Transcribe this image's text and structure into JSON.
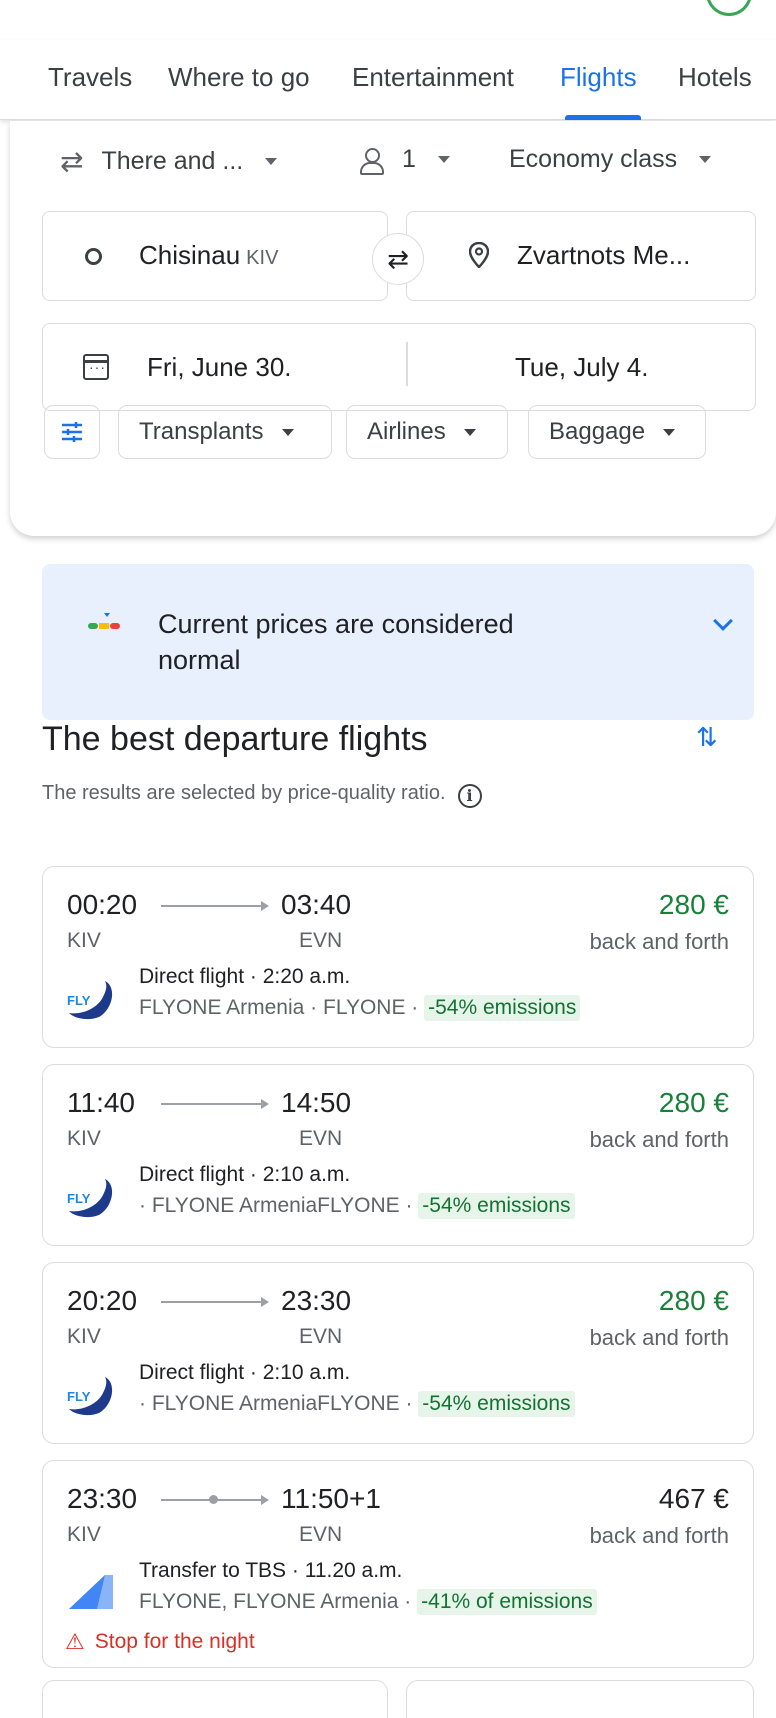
{
  "nav": {
    "tabs": [
      {
        "label": "Travels"
      },
      {
        "label": "Where to go"
      },
      {
        "label": "Entertainment"
      },
      {
        "label": "Flights"
      },
      {
        "label": "Hotels"
      }
    ],
    "active": "Flights"
  },
  "search": {
    "trip_type": "There and ...",
    "passengers": "1",
    "cabin": "Economy class",
    "origin_city": "Chisinau",
    "origin_code": "KIV",
    "destination": "Zvartnots Me...",
    "depart_date": "Fri, June 30.",
    "return_date": "Tue, July 4.",
    "chips": [
      "Transplants",
      "Airlines",
      "Baggage"
    ]
  },
  "insight": {
    "text": "Current prices are considered normal"
  },
  "results": {
    "title": "The best departure flights",
    "subtitle": "The results are selected by price-quality ratio."
  },
  "flights": [
    {
      "depart_time": "00:20",
      "arrive_time": "03:40",
      "from": "KIV",
      "to": "EVN",
      "price": "280 €",
      "price_note": "back and forth",
      "summary": "Direct flight · 2:20 a.m.",
      "airline": "FLYONE Armenia · FLYONE · ",
      "emissions": "-54% emissions"
    },
    {
      "depart_time": "11:40",
      "arrive_time": "14:50",
      "from": "KIV",
      "to": "EVN",
      "price": "280 €",
      "price_note": "back and forth",
      "summary": "Direct flight · 2:10 a.m.",
      "airline": " · FLYONE ArmeniaFLYONE · ",
      "emissions": "-54% emissions"
    },
    {
      "depart_time": "20:20",
      "arrive_time": "23:30",
      "from": "KIV",
      "to": "EVN",
      "price": "280 €",
      "price_note": "back and forth",
      "summary": "Direct flight · 2:10 a.m.",
      "airline": " · FLYONE ArmeniaFLYONE · ",
      "emissions": "-54% emissions"
    },
    {
      "depart_time": "23:30",
      "arrive_time": "11:50+1",
      "from": "KIV",
      "to": "EVN",
      "price": "467 €",
      "price_note": "back and forth",
      "summary": "Transfer to TBS · 11.20 a.m.",
      "airline": "FLYONE, FLYONE Armenia · ",
      "emissions": "-41% of emissions",
      "warning": "Stop for the night"
    }
  ],
  "colors": {
    "accent": "#1a73e8",
    "price_green": "#188038",
    "emissions_bg": "#e6f4ea",
    "warning": "#d93025",
    "insight_bg": "#e8f0fe"
  }
}
